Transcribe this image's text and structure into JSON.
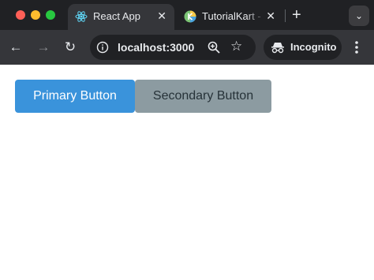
{
  "browser": {
    "tabs": [
      {
        "title": "React App",
        "favicon": "react-icon",
        "active": true,
        "close": "✕"
      },
      {
        "title": "TutorialKart -",
        "favicon": "tutorialkart-icon",
        "active": false,
        "close": "✕"
      }
    ],
    "new_tab": "+",
    "tab_search": "⌄",
    "toolbar": {
      "back": "←",
      "forward": "→",
      "reload": "↻",
      "url": "localhost:3000",
      "star": "☆",
      "incognito_label": "Incognito"
    },
    "colors": {
      "frame": "#202124",
      "toolbar": "#35363a",
      "text": "#e8eaed"
    }
  },
  "page": {
    "primary_button": {
      "label": "Primary Button",
      "color": "#3a93db"
    },
    "secondary_button": {
      "label": "Secondary Button",
      "color": "#8c9ba1"
    }
  }
}
